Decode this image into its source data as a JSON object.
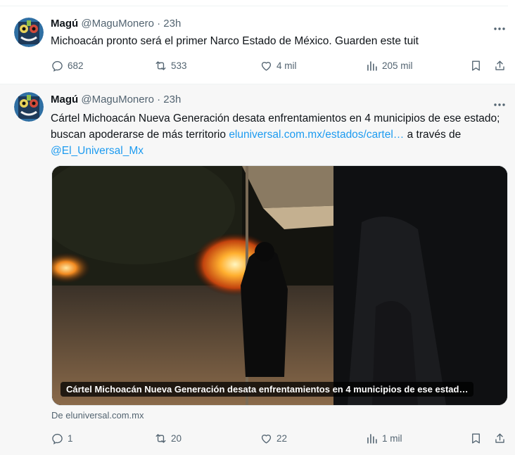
{
  "tweets": [
    {
      "name": "Magú",
      "handle": "@MaguMonero",
      "separator": "·",
      "time": "23h",
      "text": "Michoacán pronto será el primer Narco Estado de México. Guarden este tuit",
      "replies": "682",
      "retweets": "533",
      "likes": "4 mil",
      "views": "205 mil"
    },
    {
      "name": "Magú",
      "handle": "@MaguMonero",
      "separator": "·",
      "time": "23h",
      "text_part1": "Cártel Michoacán Nueva Generación desata enfrentamientos en 4 municipios de ese estado; buscan apoderarse de más territorio ",
      "link_url": "eluniversal.com.mx/estados/cartel…",
      "text_part2": " a través de ",
      "mention": "@El_Universal_Mx",
      "media_caption": "Cártel Michoacán Nueva Generación desata enfrentamientos en 4 municipios de ese estad…",
      "source": "De eluniversal.com.mx",
      "replies": "1",
      "retweets": "20",
      "likes": "22",
      "views": "1 mil"
    }
  ],
  "colors": {
    "text": "#0f1419",
    "secondary": "#536471",
    "link": "#1d9bf0",
    "highlight_bg": "#f7f7f7"
  },
  "icons": [
    "more-icon",
    "reply-icon",
    "retweet-icon",
    "like-icon",
    "views-icon",
    "bookmark-icon",
    "share-icon"
  ]
}
